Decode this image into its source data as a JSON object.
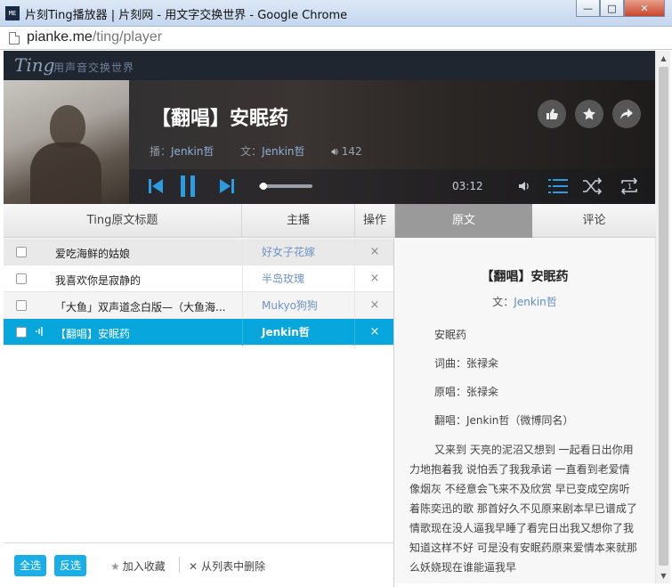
{
  "window": {
    "title": "片刻Ting播放器 | 片刻网 - 用文字交换世界 - Google Chrome",
    "logo_text": "ME",
    "minimize": "—",
    "maximize": "□",
    "close": "✕"
  },
  "address": {
    "host": "pianke.me",
    "path": "/ting/player"
  },
  "brand": {
    "name": "Ting",
    "slogan": "用声音交换世界"
  },
  "now_playing": {
    "title": "【翻唱】安眠药",
    "anchor_label": "播：",
    "anchor": "Jenkin哲",
    "author_label": "文：",
    "author": "Jenkin哲",
    "plays": "142",
    "time": "03:12",
    "progress": 0.05
  },
  "list": {
    "headers": {
      "title": "Ting原文标题",
      "anchor": "主播",
      "op": "操作"
    },
    "rows": [
      {
        "title": "爱吃海鲜的姑娘",
        "anchor": "好女子花嫁",
        "del": "×"
      },
      {
        "title": "我喜欢你是寂静的",
        "anchor": "半岛玫瑰",
        "del": "×"
      },
      {
        "title": "「大鱼」双声道念白版—（大鱼海...",
        "anchor": "Mukyo狗狗",
        "del": "×"
      },
      {
        "title": "【翻唱】安眠药",
        "anchor": "Jenkin哲",
        "del": "×"
      }
    ]
  },
  "tabs": {
    "original": "原文",
    "comments": "评论"
  },
  "footer": {
    "select_all": "全选",
    "invert": "反选",
    "favorite": "加入收藏",
    "remove": "从列表中删除"
  },
  "lyrics": {
    "title": "【翻唱】安眠药",
    "author_label": "文：",
    "author": "Jenkin哲",
    "lines": [
      "安眠药",
      "词曲：张禄籴",
      "原唱：张禄籴",
      "翻唱：Jenkin哲（微博同名）"
    ],
    "paragraph": "又来到 天亮的泥沼又想到 一起看日出你用力地抱着我 说怕丢了我我承诺 一直看到老爱情像烟灰 不经意会飞来不及欣赏 早已变成空房听着陈奕迅的歌 那首好久不见原来剧本早已谱成了情歌现在没人逼我早睡了看完日出我又想你了我知道这样不好 可是没有安眠药原来爱情本来就那么妖娆现在谁能逼我早"
  }
}
